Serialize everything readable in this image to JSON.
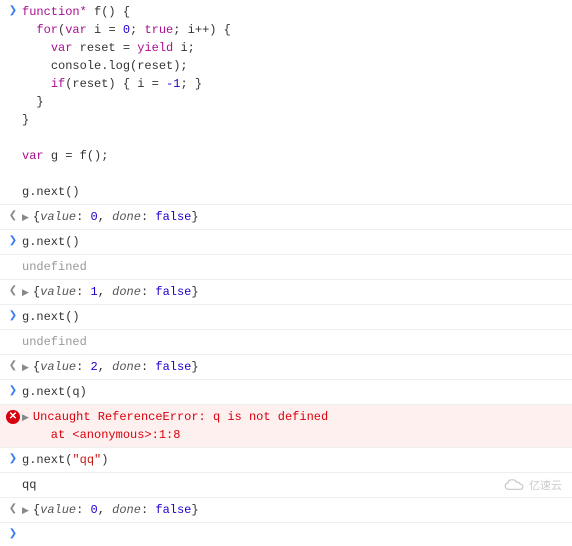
{
  "code": {
    "l1": {
      "kw1": "function*",
      "fn": "f",
      "brace": "() {"
    },
    "l2": {
      "kw": "for",
      "kw2": "var",
      "v": "i",
      "eq": "=",
      "n": "0",
      "kw3": "true",
      "inc": "i++",
      "rest": "; ; ) {"
    },
    "l3": {
      "kw": "var",
      "v": "reset",
      "eq": "=",
      "kw2": "yield",
      "v2": "i",
      "semi": ";"
    },
    "l4": {
      "txt": "console.log(reset);"
    },
    "l5": {
      "kw": "if",
      "txt": "(reset) { i = ",
      "n": "-1",
      "txt2": "; }"
    },
    "l6": "}",
    "l7": "}",
    "l8": {
      "kw": "var",
      "txt": "g = f();"
    },
    "l9": "g.next()"
  },
  "rows": [
    {
      "type": "result",
      "prop1": "value",
      "val1": "0",
      "prop2": "done",
      "val2": "false"
    },
    {
      "type": "input",
      "text": "g.next()"
    },
    {
      "type": "log",
      "text": "undefined"
    },
    {
      "type": "result",
      "prop1": "value",
      "val1": "1",
      "prop2": "done",
      "val2": "false"
    },
    {
      "type": "input",
      "text": "g.next()"
    },
    {
      "type": "log",
      "text": "undefined"
    },
    {
      "type": "result",
      "prop1": "value",
      "val1": "2",
      "prop2": "done",
      "val2": "false"
    },
    {
      "type": "input",
      "text": "g.next(q)"
    },
    {
      "type": "error",
      "l1": "Uncaught ReferenceError: q is not defined",
      "l2": "    at <anonymous>:1:8"
    },
    {
      "type": "input",
      "text": "g.next(\"qq\")",
      "display": "g.next(",
      "str": "\"qq\"",
      "close": ")"
    },
    {
      "type": "log",
      "text": "qq"
    },
    {
      "type": "result",
      "prop1": "value",
      "val1": "0",
      "prop2": "done",
      "val2": "false"
    }
  ],
  "watermark": "亿速云"
}
